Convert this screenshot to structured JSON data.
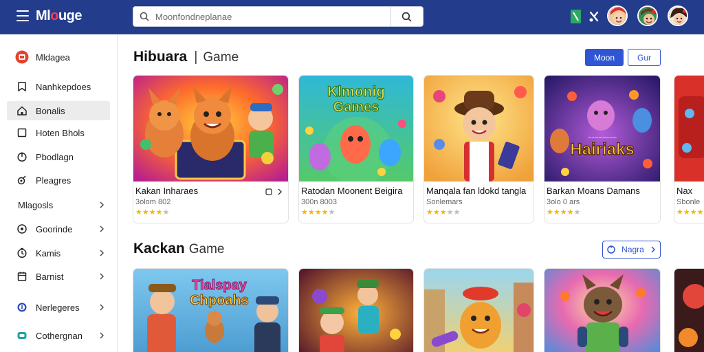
{
  "app": {
    "logo_text": "Mlouge",
    "search_placeholder": "Moonfondneplanae"
  },
  "topbar": {
    "icons": [
      "app-tile-icon",
      "puzzle-icon"
    ],
    "avatars": [
      "avatar-1",
      "avatar-2",
      "avatar-3"
    ]
  },
  "sidebar": {
    "items": [
      {
        "label": "Mldagea",
        "icon": "brand-badge-icon",
        "chevron": false
      },
      {
        "label": "Nanhkepdoes",
        "icon": "bookmark-icon",
        "chevron": false
      },
      {
        "label": "Bonalis",
        "icon": "home-icon",
        "chevron": false,
        "active": true
      },
      {
        "label": "Hoten Bhols",
        "icon": "square-icon",
        "chevron": false
      },
      {
        "label": "Pbodlagn",
        "icon": "circle-power-icon",
        "chevron": false
      },
      {
        "label": "Pleagres",
        "icon": "flask-icon",
        "chevron": false
      },
      {
        "label": "Mlagosls",
        "icon": "",
        "chevron": true
      },
      {
        "label": "Goorinde",
        "icon": "settings-icon",
        "chevron": true
      },
      {
        "label": "Kamis",
        "icon": "clock-icon",
        "chevron": true
      },
      {
        "label": "Barnist",
        "icon": "calendar-icon",
        "chevron": true
      },
      {
        "label": "Nerlegeres",
        "icon": "info-icon",
        "chevron": true
      },
      {
        "label": "Cothergnan",
        "icon": "chat-icon",
        "chevron": true
      }
    ]
  },
  "section1": {
    "title": "Hibuara",
    "subtitle": "Game",
    "primary_button": "Moon",
    "secondary_button": "Gur",
    "cards": [
      {
        "title": "Kakan Inharaes",
        "meta": "3olom 802",
        "rating": 4,
        "image_text": ""
      },
      {
        "title": "Ratodan Moonent Beigira",
        "meta": "300n 8003",
        "rating": 4,
        "image_text": "Klmonig Games"
      },
      {
        "title": "Manqala fan ldokd tangla",
        "meta": "Sonlemars",
        "rating": 3,
        "image_text": ""
      },
      {
        "title": "Barkan Moans Damans",
        "meta": "3olo 0 ars",
        "rating": 4,
        "image_text": "Hairiaks"
      },
      {
        "title": "Nax",
        "meta": "Sbonle",
        "rating": 4,
        "image_text": ""
      }
    ]
  },
  "section2": {
    "title": "Kackan",
    "subtitle": "Game",
    "more_button": "Nagra",
    "cards": [
      {
        "image_text": "Tialspay Chpoahs"
      },
      {
        "image_text": ""
      },
      {
        "image_text": ""
      },
      {
        "image_text": ""
      },
      {
        "image_text": ""
      }
    ]
  },
  "colors": {
    "topbar": "#233d8c",
    "accent": "#2f55d4",
    "star": "#f3b900",
    "logo_highlight": "#ff3b55"
  }
}
